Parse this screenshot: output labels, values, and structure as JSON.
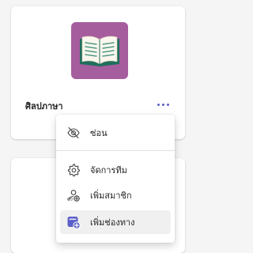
{
  "team": {
    "name": "ศิลปภาษา",
    "avatar_color": "#a65d9e",
    "avatar_icon": "book-icon"
  },
  "menu": {
    "items": [
      {
        "label": "ซ่อน",
        "icon": "eye-off-icon"
      },
      {
        "label": "จัดการทีม",
        "icon": "gear-icon"
      },
      {
        "label": "เพิ่มสมาชิก",
        "icon": "add-person-icon"
      },
      {
        "label": "เพิ่มช่องทาง",
        "icon": "add-channel-icon"
      }
    ]
  },
  "colors": {
    "accent": "#5b5fc7",
    "hover": "#f0f0f0"
  }
}
